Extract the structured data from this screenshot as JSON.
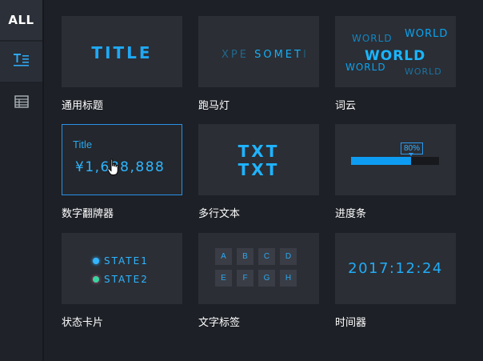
{
  "sidebar": {
    "all_label": "ALL",
    "items": [
      {
        "name": "text",
        "icon": "text-format-icon"
      },
      {
        "name": "table",
        "icon": "table-icon"
      }
    ]
  },
  "colors": {
    "accent": "#1fa9f5",
    "background": "#1d2026",
    "card": "#2b2e35",
    "selected_border": "#2a91e6"
  },
  "cards": {
    "title": {
      "label": "通用标题",
      "preview": "TITLE"
    },
    "marquee": {
      "label": "跑马灯",
      "preview_left": "XPE",
      "preview_mid": " SOMET",
      "preview_right": "I"
    },
    "wordcloud": {
      "label": "词云",
      "words": [
        "WORLD",
        "WORLD",
        "WORLD",
        "WORLD",
        "WORLD"
      ]
    },
    "counter": {
      "label": "数字翻牌器",
      "title": "Title",
      "value": "¥1,688,888"
    },
    "multiline": {
      "label": "多行文本",
      "line1": "TXT",
      "line2": "TXT"
    },
    "progress": {
      "label": "进度条",
      "value_text": "80%",
      "value": 0.68
    },
    "status": {
      "label": "状态卡片",
      "state1": "STATE1",
      "state2": "STATE2"
    },
    "tags": {
      "label": "文字标签",
      "letters": [
        "A",
        "B",
        "C",
        "D",
        "E",
        "F",
        "G",
        "H"
      ]
    },
    "timer": {
      "label": "时间器",
      "time": "2017:12:24"
    }
  }
}
